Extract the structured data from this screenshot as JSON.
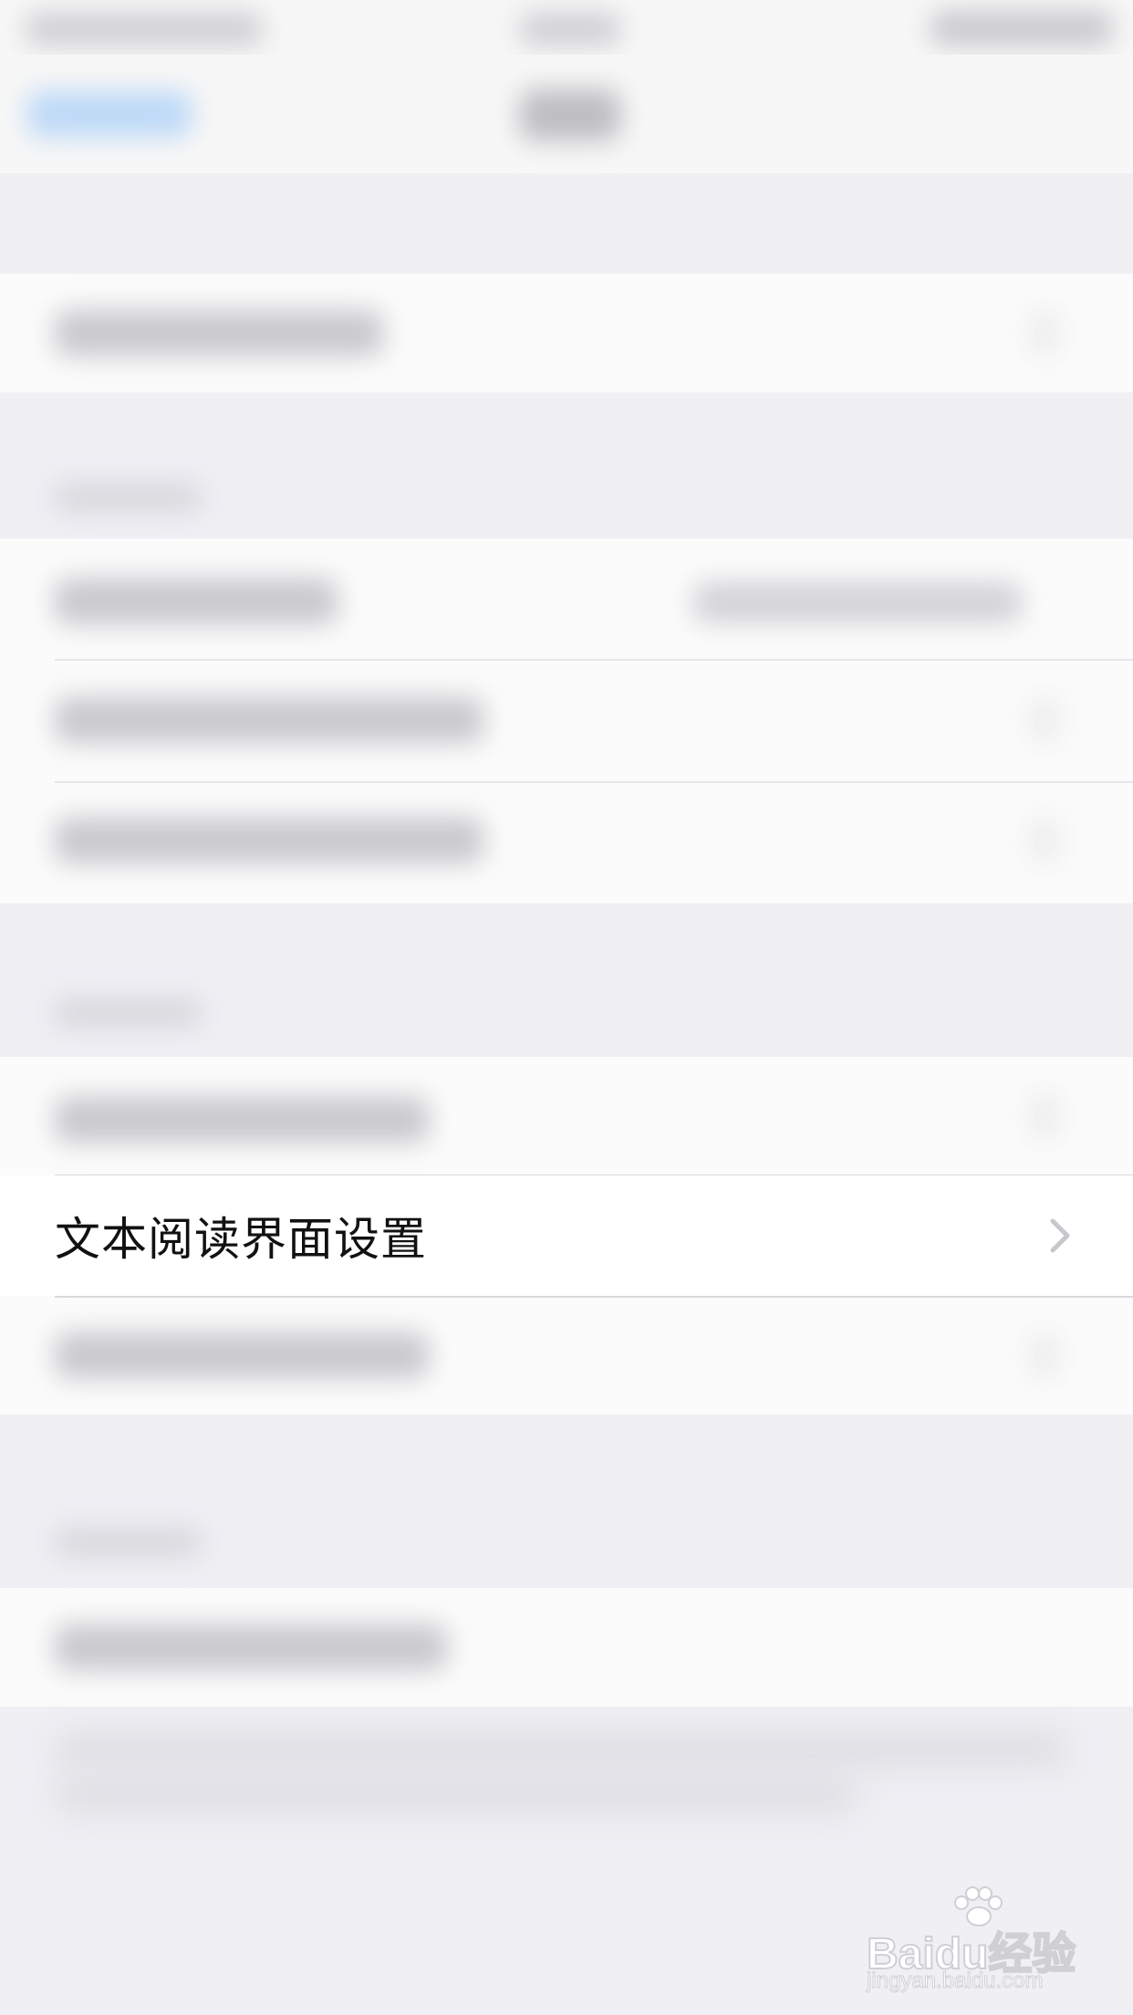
{
  "screen": {
    "focused_row": {
      "label": "文本阅读界面设置"
    },
    "watermark": {
      "brand": "Baidu经验",
      "site": "jingyan.baidu.com"
    },
    "colors": {
      "background": "#efeff4",
      "cell": "#ffffff",
      "text": "#111111",
      "chevron": "#c7c7cc",
      "accent_blur": "#bcd8f7"
    },
    "icons": {
      "chevron": "chevron-right-icon",
      "watermark_logo": "paw-icon"
    }
  }
}
